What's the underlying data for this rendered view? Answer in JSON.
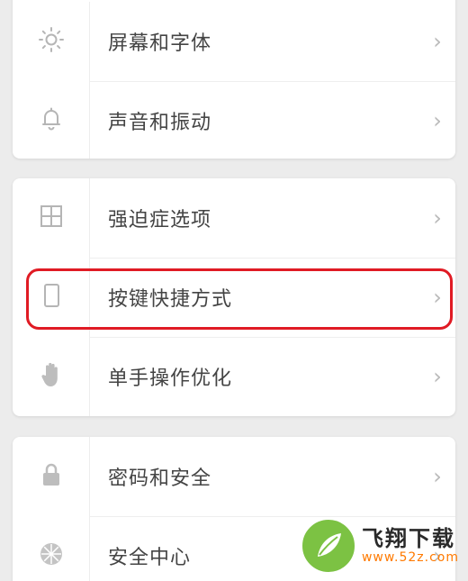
{
  "groups": [
    {
      "items": [
        {
          "label": "屏幕和字体",
          "icon": "sun-icon",
          "chevron": "›"
        },
        {
          "label": "声音和振动",
          "icon": "bell-icon",
          "chevron": "›"
        }
      ]
    },
    {
      "items": [
        {
          "label": "强迫症选项",
          "icon": "grid-icon",
          "chevron": "›"
        },
        {
          "label": "按键快捷方式",
          "icon": "phone-icon",
          "chevron": "›"
        },
        {
          "label": "单手操作优化",
          "icon": "hand-icon",
          "chevron": "›"
        }
      ]
    },
    {
      "items": [
        {
          "label": "密码和安全",
          "icon": "lock-icon",
          "chevron": "›"
        },
        {
          "label": "安全中心",
          "icon": "shield-badge-icon",
          "chevron": "›"
        }
      ]
    }
  ],
  "highlight": {
    "target": "按键快捷方式",
    "color": "#e01b24"
  },
  "watermark": {
    "main": "飞翔下载",
    "sub": "www.52z.com"
  },
  "colors": {
    "background": "#ececec",
    "card": "#ffffff",
    "icon": "#b5b5b5",
    "label": "#444444"
  }
}
